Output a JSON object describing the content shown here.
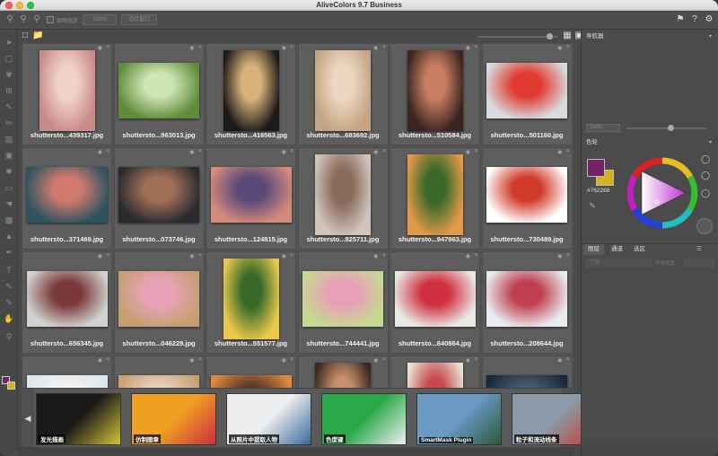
{
  "window": {
    "title": "AliveColors 9.7 Business"
  },
  "toolbar": {
    "checkbox_label": "缩略缩放",
    "zoom_value": "100%",
    "fit_button": "适合窗口"
  },
  "files": [
    {
      "name": "shuttersto...439317.jpg",
      "c1": "#c98a8a",
      "c2": "#f0d2c6"
    },
    {
      "name": "shuttersto...963013.jpg",
      "c1": "#5f8c3a",
      "c2": "#cfe4b4"
    },
    {
      "name": "shuttersto...416563.jpg",
      "c1": "#1e1a18",
      "c2": "#d7b27c"
    },
    {
      "name": "shuttersto...683692.jpg",
      "c1": "#c4a482",
      "c2": "#ecd7c2"
    },
    {
      "name": "shuttersto...510584.jpg",
      "c1": "#3a2520",
      "c2": "#c87e62"
    },
    {
      "name": "shuttersto...501160.jpg",
      "c1": "#d6dcde",
      "c2": "#e23a30"
    },
    {
      "name": "shuttersto...371469.jpg",
      "c1": "#2e5460",
      "c2": "#d07a6e"
    },
    {
      "name": "shuttersto...073746.jpg",
      "c1": "#2a2a30",
      "c2": "#a27058"
    },
    {
      "name": "shuttersto...124815.jpg",
      "c1": "#d48a7a",
      "c2": "#5a4a7a"
    },
    {
      "name": "shuttersto...825711.jpg",
      "c1": "#cfc5bc",
      "c2": "#8a6a5a"
    },
    {
      "name": "shuttersto...947963.jpg",
      "c1": "#e09a48",
      "c2": "#3a6a2a"
    },
    {
      "name": "shuttersto...730489.jpg",
      "c1": "#ffffff",
      "c2": "#d03a2a"
    },
    {
      "name": "shuttersto...656345.jpg",
      "c1": "#d0d2d0",
      "c2": "#7a3a3a"
    },
    {
      "name": "shuttersto...046229.jpg",
      "c1": "#c4a070",
      "c2": "#e8a2b8"
    },
    {
      "name": "shuttersto...551577.jpg",
      "c1": "#e8c84a",
      "c2": "#3a6a2a"
    },
    {
      "name": "shuttersto...744441.jpg",
      "c1": "#c6d890",
      "c2": "#e8a0b8"
    },
    {
      "name": "shuttersto...840864.jpg",
      "c1": "#e8e8e4",
      "c2": "#d03040"
    },
    {
      "name": "shuttersto...208644.jpg",
      "c1": "#e8ecf0",
      "c2": "#c04050"
    },
    {
      "name": "",
      "c1": "#dde4ea",
      "c2": "#f2f2f2"
    },
    {
      "name": "",
      "c1": "#c8a074",
      "c2": "#e4d0bc"
    },
    {
      "name": "",
      "c1": "#e08a40",
      "c2": "#5a3a2a"
    },
    {
      "name": "",
      "c1": "#3a2a22",
      "c2": "#c8906a"
    },
    {
      "name": "",
      "c1": "#e8e0d0",
      "c2": "#c84a50"
    },
    {
      "name": "",
      "c1": "#1a2a3a",
      "c2": "#4a5a6a"
    }
  ],
  "filmstrip": [
    {
      "label": "发光描画",
      "c1": "#1a1a1a",
      "c2": "#d4c432"
    },
    {
      "label": "仿制图章",
      "c1": "#f0a020",
      "c2": "#c83040"
    },
    {
      "label": "从照片中提取人物",
      "c1": "#eeeeee",
      "c2": "#3a6a9a"
    },
    {
      "label": "色度键",
      "c1": "#2aa84a",
      "c2": "#f0f0f0"
    },
    {
      "label": "SmartMask Plugin",
      "c1": "#6a9ac4",
      "c2": "#2a5a3a"
    },
    {
      "label": "粒子和流动线条",
      "c1": "#8a9aa8",
      "c2": "#c43a30"
    }
  ],
  "panels": {
    "navigator": "导航器",
    "nav_zoom": "100%",
    "color_wheel": "色轮",
    "hex": "#762268",
    "fg_color": "#762268",
    "bg_color": "#d4b21c",
    "tabs": [
      "图层",
      "通道",
      "选区"
    ],
    "blend_mode": "正常",
    "opacity_label": "不透明度:"
  }
}
